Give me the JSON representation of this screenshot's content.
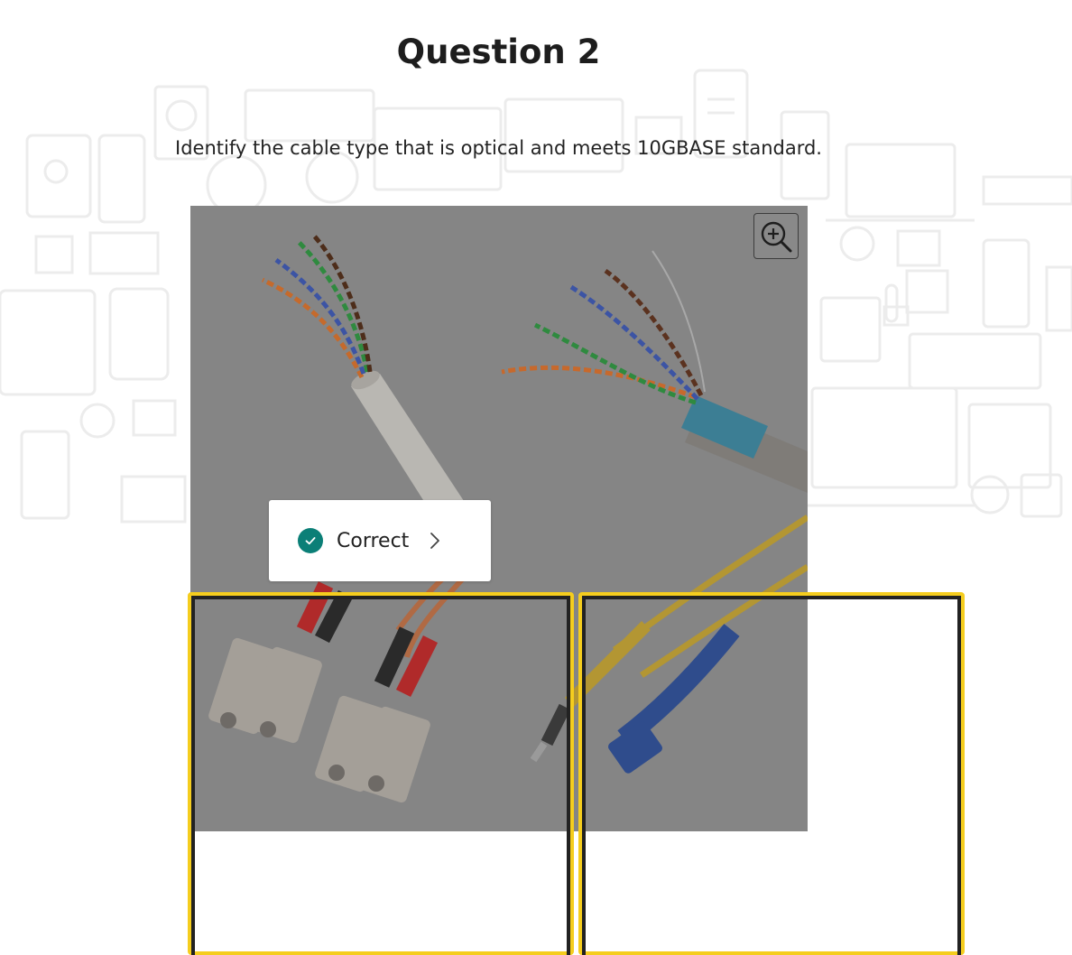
{
  "question": {
    "title": "Question 2",
    "prompt": "Identify the cable type that is optical and meets 10GBASE standard."
  },
  "image": {
    "subject": "twisted-pair-and-fiber-optic-cables-photo",
    "zoom_icon": "zoom-in-icon"
  },
  "feedback": {
    "status": "correct",
    "label": "Correct",
    "icon": "check-circle-icon",
    "chevron": "chevron-right-icon"
  },
  "hotspots": [
    {
      "name": "hotspot-sc-duplex-connectors"
    },
    {
      "name": "hotspot-sc-single-connector"
    }
  ],
  "colors": {
    "hotspot_outline": "#f5cd1e",
    "hotspot_inner": "#222222",
    "success": "#0b7f77",
    "overlay": "#868686"
  }
}
